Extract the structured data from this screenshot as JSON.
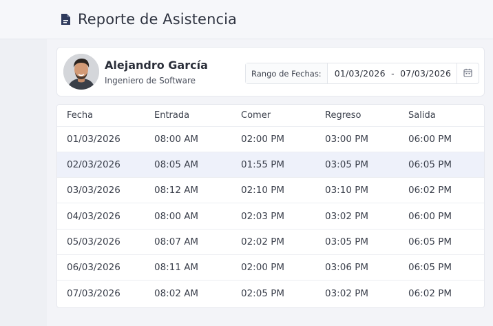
{
  "header": {
    "title": "Reporte de Asistencia",
    "icon": "document-icon"
  },
  "profile": {
    "name": "Alejandro García",
    "role": "Ingeniero de Software"
  },
  "date_range": {
    "label": "Rango de Fechas:",
    "value": "01/03/2026  -  07/03/2026",
    "icon": "calendar-icon"
  },
  "table": {
    "columns": [
      "Fecha",
      "Entrada",
      "Comer",
      "Regreso",
      "Salida"
    ],
    "rows": [
      [
        "01/03/2026",
        "08:00 AM",
        "02:00 PM",
        "03:00 PM",
        "06:00 PM"
      ],
      [
        "02/03/2026",
        "08:05 AM",
        "01:55 PM",
        "03:05 PM",
        "06:05 PM"
      ],
      [
        "03/03/2026",
        "08:12 AM",
        "02:10 PM",
        "03:10 PM",
        "06:02 PM"
      ],
      [
        "04/03/2026",
        "08:00 AM",
        "02:03 PM",
        "03:02 PM",
        "06:00 PM"
      ],
      [
        "05/03/2026",
        "08:07 AM",
        "02:02 PM",
        "03:05 PM",
        "06:05 PM"
      ],
      [
        "06/03/2026",
        "08:11 AM",
        "02:00 PM",
        "03:06 PM",
        "06:05 PM"
      ],
      [
        "07/03/2026",
        "08:02 AM",
        "02:05 PM",
        "03:02 PM",
        "06:02 PM"
      ]
    ],
    "highlighted_row": 1
  },
  "colors": {
    "accent": "#2e3a5c",
    "row_highlight": "#eef1fa"
  }
}
